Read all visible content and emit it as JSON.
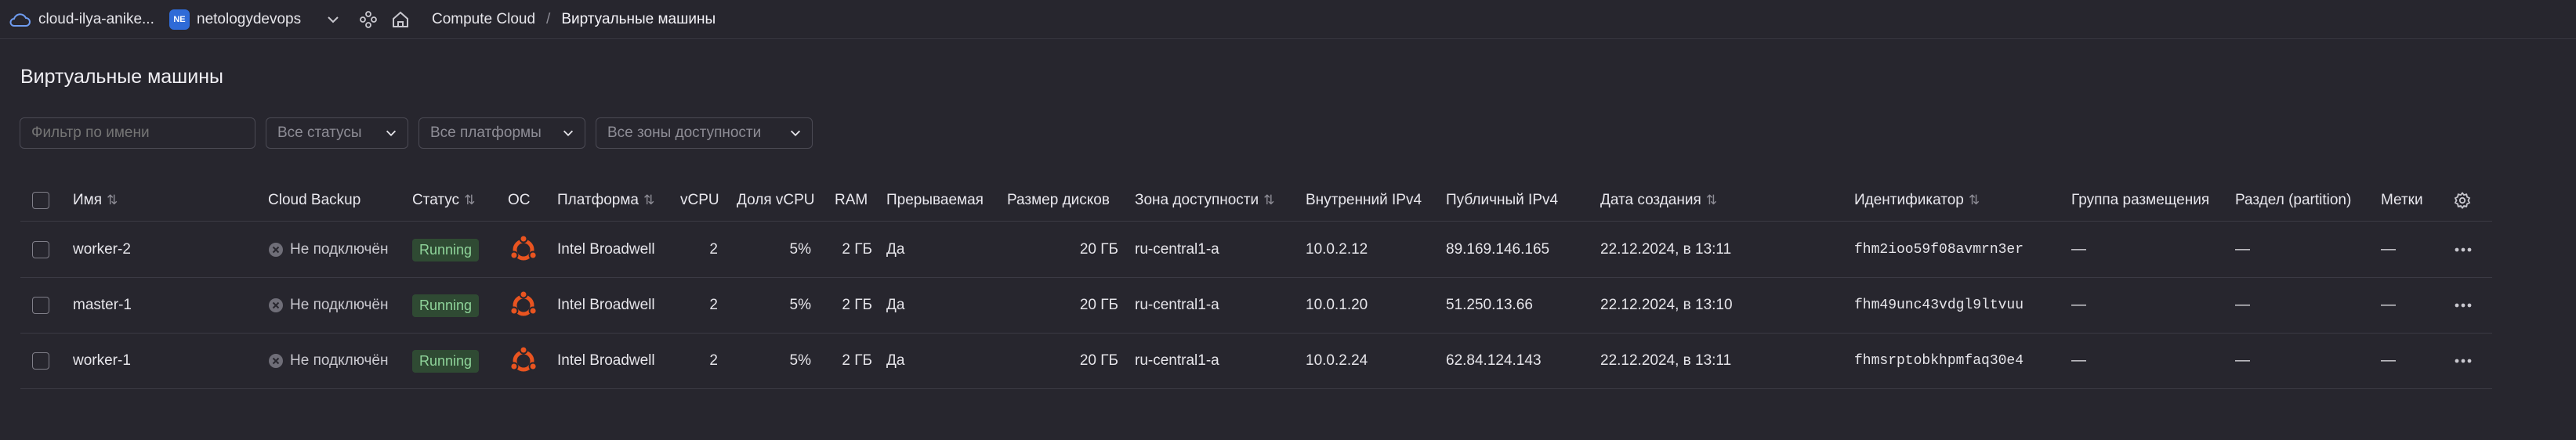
{
  "topbar": {
    "cloud_name": "cloud-ilya-anike...",
    "org_badge": "NE",
    "org_name": "netologydevops",
    "breadcrumb_service": "Compute Cloud",
    "breadcrumb_sep": "/",
    "breadcrumb_current": "Виртуальные машины"
  },
  "page": {
    "title": "Виртуальные машины"
  },
  "filters": {
    "name_placeholder": "Фильтр по имени",
    "status": "Все статусы",
    "platform": "Все платформы",
    "zone": "Все зоны доступности"
  },
  "table": {
    "headers": {
      "name": "Имя",
      "backup": "Cloud Backup",
      "status": "Статус",
      "os": "ОС",
      "platform": "Платформа",
      "vcpu": "vCPU",
      "vcpu_share": "Доля vCPU",
      "ram": "RAM",
      "preemptible": "Прерываемая",
      "disk": "Размер дисков",
      "zone": "Зона доступности",
      "ipv4_int": "Внутренний IPv4",
      "ipv4_pub": "Публичный IPv4",
      "created": "Дата создания",
      "id": "Идентификатор",
      "placement": "Группа размещения",
      "partition": "Раздел (partition)",
      "labels": "Метки"
    },
    "rows": [
      {
        "name": "worker-2",
        "backup": "Не подключён",
        "status": "Running",
        "platform": "Intel Broadwell",
        "vcpu": "2",
        "vcpu_share": "5%",
        "ram": "2 ГБ",
        "preemptible": "Да",
        "disk": "20 ГБ",
        "zone": "ru-central1-a",
        "ipv4_int": "10.0.2.12",
        "ipv4_pub": "89.169.146.165",
        "created": "22.12.2024, в 13:11",
        "id": "fhm2ioo59f08avmrn3er",
        "placement": "—",
        "partition": "—",
        "labels": "—"
      },
      {
        "name": "master-1",
        "backup": "Не подключён",
        "status": "Running",
        "platform": "Intel Broadwell",
        "vcpu": "2",
        "vcpu_share": "5%",
        "ram": "2 ГБ",
        "preemptible": "Да",
        "disk": "20 ГБ",
        "zone": "ru-central1-a",
        "ipv4_int": "10.0.1.20",
        "ipv4_pub": "51.250.13.66",
        "created": "22.12.2024, в 13:10",
        "id": "fhm49unc43vdgl9ltvuu",
        "placement": "—",
        "partition": "—",
        "labels": "—"
      },
      {
        "name": "worker-1",
        "backup": "Не подключён",
        "status": "Running",
        "platform": "Intel Broadwell",
        "vcpu": "2",
        "vcpu_share": "5%",
        "ram": "2 ГБ",
        "preemptible": "Да",
        "disk": "20 ГБ",
        "zone": "ru-central1-a",
        "ipv4_int": "10.0.2.24",
        "ipv4_pub": "62.84.124.143",
        "created": "22.12.2024, в 13:11",
        "id": "fhmsrptobkhpmfaq30e4",
        "placement": "—",
        "partition": "—",
        "labels": "—"
      }
    ]
  },
  "colors": {
    "background": "#27262e",
    "running_bg": "#2f4a33",
    "running_text": "#8fd49a",
    "ubuntu": "#e95420",
    "org_badge": "#2f6bd7"
  }
}
